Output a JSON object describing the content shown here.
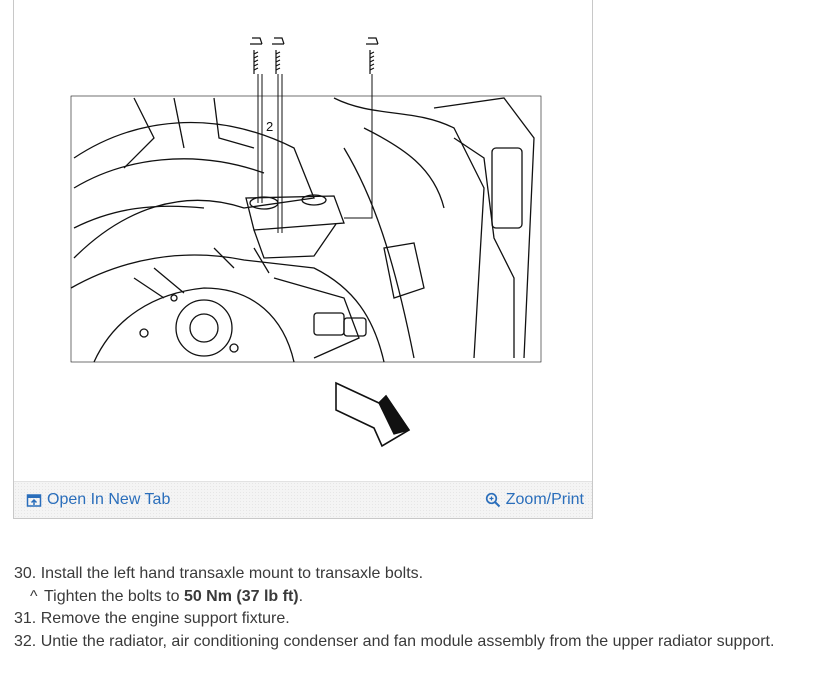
{
  "figure": {
    "open_tab_label": "Open In New Tab",
    "zoom_label": "Zoom/Print",
    "diagram_label": "2"
  },
  "steps": {
    "s30": "30. Install the left hand transaxle mount to transaxle bolts.",
    "s30_sub": {
      "marker": "^",
      "prefix": "Tighten the bolts to ",
      "value": "50 Nm (37 lb ft)",
      "suffix": "."
    },
    "s31": "31. Remove the engine support fixture.",
    "s32": "32. Untie the radiator, air conditioning condenser and fan module assembly from the upper radiator support."
  }
}
